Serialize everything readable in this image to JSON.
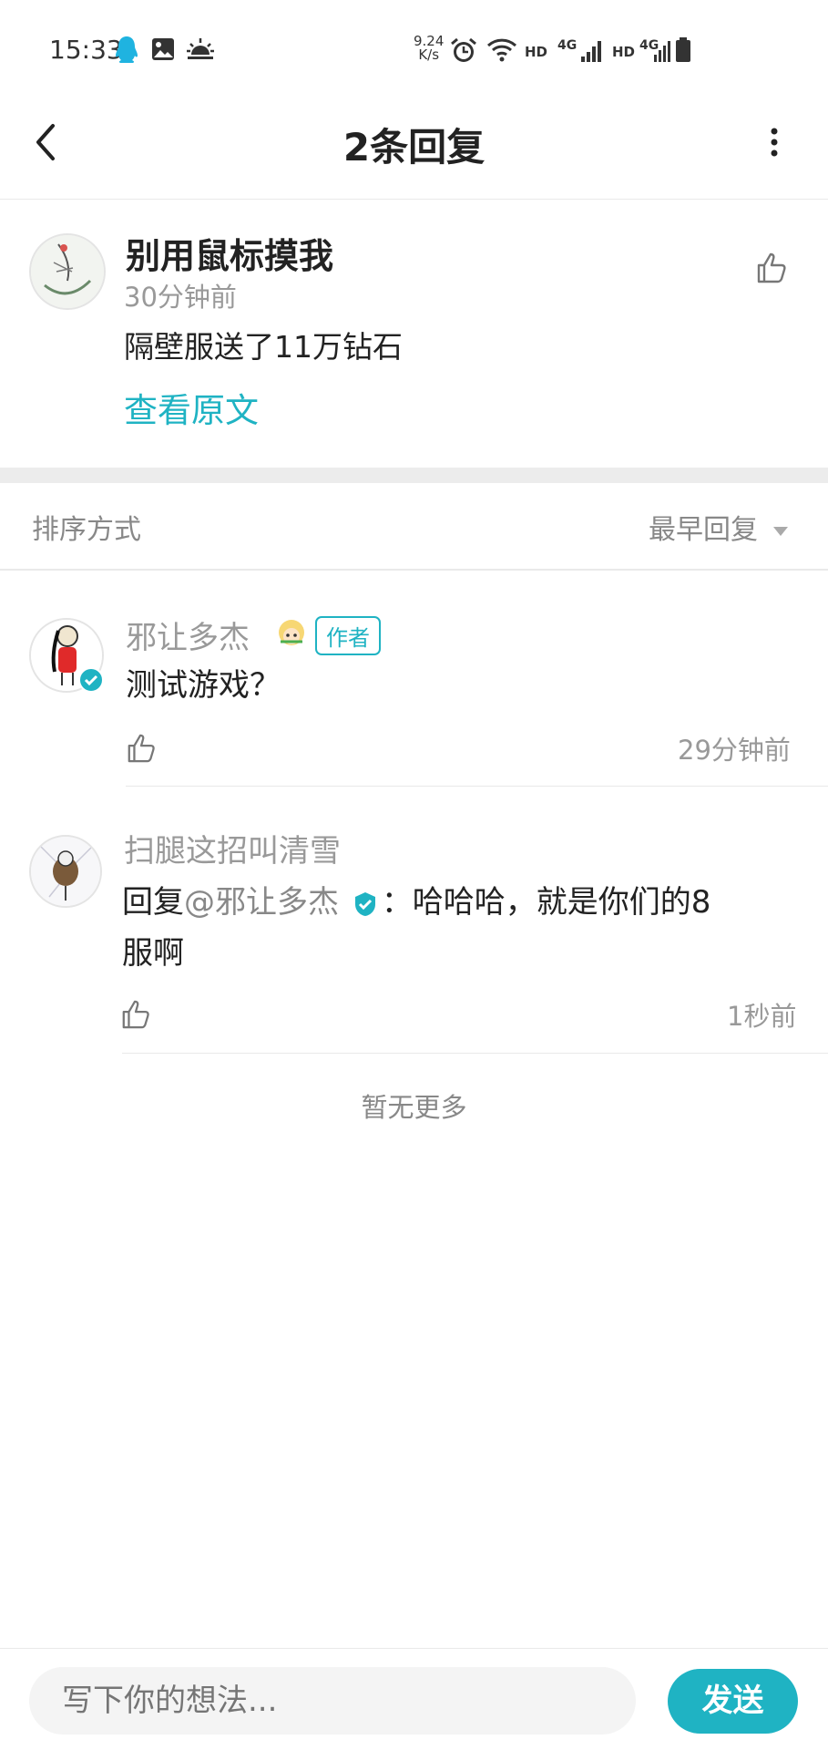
{
  "status_bar": {
    "time": "15:33",
    "net_speed_value": "9.24",
    "net_speed_unit": "K/s",
    "icons": [
      "qq-icon",
      "gallery-icon",
      "weather-icon",
      "alarm-icon",
      "wifi-icon",
      "hd-icon",
      "signal-4g-icon",
      "hd-icon",
      "signal-4g-icon",
      "battery-icon"
    ],
    "hd_label": "HD",
    "net_label": "4G"
  },
  "header": {
    "title": "2条回复",
    "back_icon": "back-arrow-icon",
    "more_icon": "more-vertical-icon"
  },
  "original_post": {
    "author": "别用鼠标摸我",
    "time": "30分钟前",
    "content": "隔壁服送了11万钻石",
    "view_original": "查看原文"
  },
  "sort": {
    "label": "排序方式",
    "value": "最早回复"
  },
  "replies": [
    {
      "author": "邪让多杰",
      "badge": "作者",
      "content": "测试游戏？",
      "time": "29分钟前",
      "verified": true
    },
    {
      "author": "扫腿这招叫清雪",
      "reply_prefix": "回复",
      "mention": "@邪让多杰",
      "content_line1": "：哈哈哈，就是你们的8",
      "content_line2": "服啊",
      "time": "1秒前"
    }
  ],
  "no_more": "暂无更多",
  "bottom_bar": {
    "input_placeholder": "写下你的想法...",
    "send_label": "发送"
  },
  "colors": {
    "accent": "#1fb3c3",
    "muted_text": "#999999",
    "divider": "#e9e9e9"
  }
}
